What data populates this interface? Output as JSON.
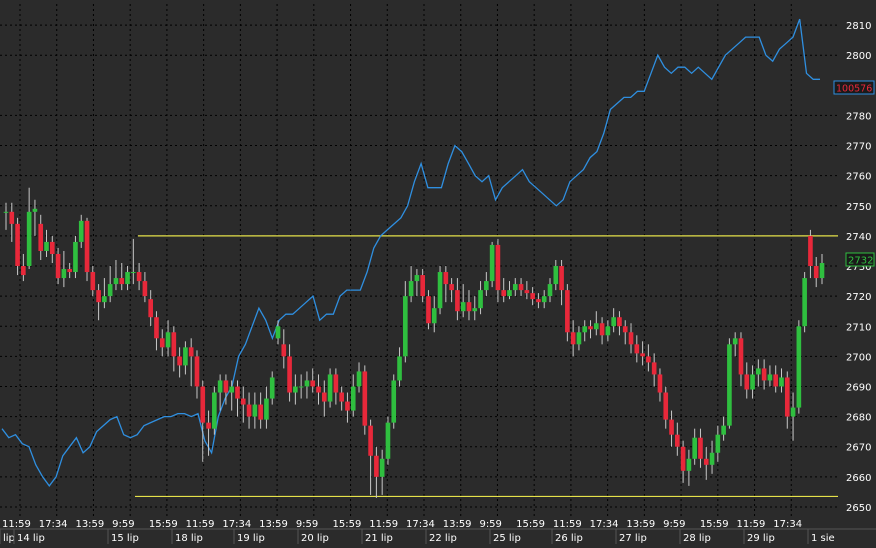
{
  "colors": {
    "background": "#2b2b2b",
    "grid": "#000000",
    "bull_candle": "#2fbf3f",
    "bear_candle": "#e8283a",
    "wick": "#c8c8c8",
    "overlay_line": "#2f8fe0",
    "level_line": "#e6e24a",
    "axis_text": "#ffffff",
    "price_box_border": "#2f8fe0",
    "price_box_text": "#e8283a",
    "last_price_box_border": "#2fbf3f",
    "last_price_box_text": "#2fbf3f"
  },
  "chart_data": {
    "type": "candlestick",
    "ylim": [
      2647,
      2817
    ],
    "y_ticks": [
      2650,
      2660,
      2670,
      2680,
      2690,
      2700,
      2710,
      2720,
      2730,
      2740,
      2750,
      2760,
      2770,
      2780,
      2800,
      2810
    ],
    "time_labels": [
      "11:59",
      "17:34",
      "13:59",
      "9:59",
      "15:59",
      "11:59",
      "17:34",
      "13:59",
      "9:59",
      "15:59",
      "11:59",
      "17:34",
      "13:59",
      "9:59",
      "15:59",
      "11:59",
      "17:34",
      "13:59",
      "9:59",
      "15:59",
      "11:59",
      "17:34"
    ],
    "day_labels": [
      "lip",
      "14 lip",
      "15 lip",
      "18 lip",
      "19 lip",
      "20 lip",
      "21 lip",
      "22 lip",
      "25 lip",
      "26 lip",
      "27 lip",
      "28 lip",
      "29 lip",
      "1 sie"
    ],
    "horizontal_levels": [
      2740,
      2653.5
    ],
    "overlay_price_label": "100576",
    "last_price_label": "2732",
    "last_price": 2732,
    "candles": [
      [
        2748,
        2748,
        2751,
        2742
      ],
      [
        2748,
        2744,
        2751,
        2738
      ],
      [
        2744,
        2730,
        2746,
        2727
      ],
      [
        2730,
        2727,
        2734,
        2725
      ],
      [
        2730,
        2748,
        2756,
        2729
      ],
      [
        2748,
        2749,
        2752,
        2740
      ],
      [
        2744,
        2735,
        2747,
        2732
      ],
      [
        2735,
        2738,
        2742,
        2733
      ],
      [
        2738,
        2734,
        2740,
        2731
      ],
      [
        2734,
        2726,
        2736,
        2724
      ],
      [
        2726,
        2729,
        2735,
        2723
      ],
      [
        2729,
        2728,
        2731,
        2726
      ],
      [
        2728,
        2738,
        2740,
        2726
      ],
      [
        2738,
        2745,
        2747,
        2736
      ],
      [
        2745,
        2728,
        2746,
        2725
      ],
      [
        2728,
        2722,
        2730,
        2720
      ],
      [
        2722,
        2718,
        2724,
        2712
      ],
      [
        2718,
        2720,
        2726,
        2716
      ],
      [
        2720,
        2724,
        2730,
        2718
      ],
      [
        2724,
        2726,
        2732,
        2722
      ],
      [
        2726,
        2724,
        2731,
        2722
      ],
      [
        2724,
        2728,
        2730,
        2722
      ],
      [
        2728,
        2728,
        2739,
        2724
      ],
      [
        2728,
        2725,
        2731,
        2722
      ],
      [
        2725,
        2720,
        2728,
        2718
      ],
      [
        2719,
        2713,
        2722,
        2710
      ],
      [
        2713,
        2706,
        2715,
        2702
      ],
      [
        2706,
        2703,
        2709,
        2700
      ],
      [
        2703,
        2708,
        2712,
        2700
      ],
      [
        2708,
        2700,
        2710,
        2695
      ],
      [
        2700,
        2697,
        2703,
        2693
      ],
      [
        2697,
        2703,
        2705,
        2694
      ],
      [
        2703,
        2700,
        2706,
        2690
      ],
      [
        2700,
        2690,
        2702,
        2686
      ],
      [
        2690,
        2678,
        2692,
        2665
      ],
      [
        2678,
        2676,
        2682,
        2667
      ],
      [
        2676,
        2688,
        2690,
        2674
      ],
      [
        2688,
        2692,
        2694,
        2682
      ],
      [
        2692,
        2688,
        2694,
        2684
      ],
      [
        2688,
        2690,
        2692,
        2682
      ],
      [
        2690,
        2686,
        2692,
        2680
      ],
      [
        2686,
        2684,
        2690,
        2678
      ],
      [
        2684,
        2680,
        2688,
        2676
      ],
      [
        2680,
        2684,
        2688,
        2676
      ],
      [
        2684,
        2679,
        2688,
        2676
      ],
      [
        2679,
        2686,
        2690,
        2676
      ],
      [
        2686,
        2693,
        2695,
        2684
      ],
      [
        2706,
        2710,
        2712,
        2704
      ],
      [
        2704,
        2700,
        2709,
        2696
      ],
      [
        2700,
        2688,
        2704,
        2685
      ],
      [
        2688,
        2690,
        2694,
        2684
      ],
      [
        2690,
        2690,
        2694,
        2686
      ],
      [
        2690,
        2692,
        2695,
        2686
      ],
      [
        2692,
        2690,
        2696,
        2688
      ],
      [
        2690,
        2688,
        2694,
        2684
      ],
      [
        2688,
        2685,
        2692,
        2680
      ],
      [
        2685,
        2694,
        2696,
        2683
      ],
      [
        2694,
        2688,
        2696,
        2684
      ],
      [
        2688,
        2685,
        2690,
        2682
      ],
      [
        2685,
        2682,
        2688,
        2678
      ],
      [
        2682,
        2690,
        2694,
        2680
      ],
      [
        2690,
        2695,
        2698,
        2688
      ],
      [
        2695,
        2677,
        2697,
        2674
      ],
      [
        2677,
        2667,
        2679,
        2654
      ],
      [
        2667,
        2660,
        2670,
        2653
      ],
      [
        2660,
        2666,
        2669,
        2654
      ],
      [
        2666,
        2678,
        2680,
        2664
      ],
      [
        2678,
        2692,
        2694,
        2676
      ],
      [
        2692,
        2700,
        2703,
        2690
      ],
      [
        2700,
        2720,
        2725,
        2698
      ],
      [
        2720,
        2725,
        2730,
        2718
      ],
      [
        2725,
        2727,
        2729,
        2720
      ],
      [
        2727,
        2720,
        2729,
        2718
      ],
      [
        2720,
        2711,
        2722,
        2709
      ],
      [
        2711,
        2716,
        2720,
        2708
      ],
      [
        2716,
        2728,
        2730,
        2714
      ],
      [
        2728,
        2724,
        2730,
        2718
      ],
      [
        2724,
        2722,
        2726,
        2718
      ],
      [
        2722,
        2715,
        2726,
        2712
      ],
      [
        2715,
        2718,
        2724,
        2713
      ],
      [
        2718,
        2715,
        2722,
        2712
      ],
      [
        2715,
        2716,
        2720,
        2712
      ],
      [
        2716,
        2722,
        2725,
        2714
      ],
      [
        2722,
        2725,
        2728,
        2720
      ],
      [
        2725,
        2737,
        2738,
        2723
      ],
      [
        2737,
        2722,
        2739,
        2718
      ],
      [
        2722,
        2720,
        2726,
        2718
      ],
      [
        2720,
        2722,
        2725,
        2719
      ],
      [
        2722,
        2724,
        2726,
        2720
      ],
      [
        2724,
        2722,
        2726,
        2720
      ],
      [
        2722,
        2721,
        2725,
        2719
      ],
      [
        2721,
        2719,
        2723,
        2717
      ],
      [
        2719,
        2718,
        2721,
        2716
      ],
      [
        2718,
        2720,
        2722,
        2716
      ],
      [
        2720,
        2724,
        2726,
        2718
      ],
      [
        2724,
        2730,
        2732,
        2722
      ],
      [
        2730,
        2722,
        2732,
        2717
      ],
      [
        2722,
        2708,
        2724,
        2705
      ],
      [
        2708,
        2704,
        2712,
        2700
      ],
      [
        2704,
        2708,
        2710,
        2702
      ],
      [
        2708,
        2710,
        2712,
        2705
      ],
      [
        2710,
        2709,
        2712,
        2706
      ],
      [
        2709,
        2711,
        2715,
        2707
      ],
      [
        2711,
        2707,
        2713,
        2704
      ],
      [
        2707,
        2710,
        2712,
        2705
      ],
      [
        2710,
        2713,
        2716,
        2708
      ],
      [
        2713,
        2710,
        2715,
        2707
      ],
      [
        2710,
        2708,
        2712,
        2704
      ],
      [
        2708,
        2704,
        2711,
        2701
      ],
      [
        2704,
        2701,
        2707,
        2698
      ],
      [
        2701,
        2700,
        2705,
        2697
      ],
      [
        2700,
        2698,
        2704,
        2695
      ],
      [
        2698,
        2694,
        2701,
        2690
      ],
      [
        2694,
        2688,
        2696,
        2685
      ],
      [
        2688,
        2679,
        2690,
        2676
      ],
      [
        2679,
        2674,
        2682,
        2670
      ],
      [
        2674,
        2670,
        2678,
        2667
      ],
      [
        2670,
        2662,
        2672,
        2658
      ],
      [
        2662,
        2666,
        2669,
        2657
      ],
      [
        2666,
        2673,
        2676,
        2664
      ],
      [
        2673,
        2666,
        2676,
        2663
      ],
      [
        2666,
        2664,
        2670,
        2659
      ],
      [
        2664,
        2668,
        2672,
        2661
      ],
      [
        2668,
        2674,
        2677,
        2665
      ],
      [
        2674,
        2677,
        2680,
        2672
      ],
      [
        2677,
        2704,
        2706,
        2676
      ],
      [
        2704,
        2706,
        2708,
        2700
      ],
      [
        2706,
        2694,
        2708,
        2690
      ],
      [
        2694,
        2689,
        2698,
        2686
      ],
      [
        2689,
        2694,
        2697,
        2686
      ],
      [
        2694,
        2696,
        2699,
        2690
      ],
      [
        2696,
        2692,
        2699,
        2689
      ],
      [
        2692,
        2694,
        2697,
        2690
      ],
      [
        2694,
        2690,
        2697,
        2688
      ],
      [
        2690,
        2693,
        2696,
        2688
      ],
      [
        2693,
        2680,
        2695,
        2676
      ],
      [
        2680,
        2683,
        2688,
        2672
      ],
      [
        2683,
        2710,
        2712,
        2681
      ],
      [
        2710,
        2726,
        2728,
        2708
      ],
      [
        2740,
        2730,
        2742,
        2726
      ],
      [
        2730,
        2726,
        2733,
        2723
      ],
      [
        2726,
        2731,
        2734,
        2724
      ]
    ],
    "overlay_series": [
      2676,
      2673,
      2674,
      2671,
      2670,
      2664,
      2660,
      2657,
      2660,
      2667,
      2670,
      2673,
      2668,
      2670,
      2675,
      2677,
      2679,
      2680,
      2674,
      2673,
      2674,
      2677,
      2678,
      2679,
      2680,
      2680,
      2681,
      2681,
      2680,
      2681,
      2672,
      2668,
      2680,
      2686,
      2690,
      2700,
      2704,
      2710,
      2716,
      2712,
      2706,
      2712,
      2714,
      2714,
      2716,
      2718,
      2720,
      2712,
      2714,
      2714,
      2720,
      2722,
      2722,
      2722,
      2728,
      2736,
      2740,
      2742,
      2744,
      2746,
      2750,
      2758,
      2764,
      2756,
      2756,
      2756,
      2764,
      2770,
      2768,
      2764,
      2760,
      2758,
      2760,
      2752,
      2756,
      2758,
      2760,
      2762,
      2758,
      2756,
      2754,
      2752,
      2750,
      2752,
      2758,
      2760,
      2762,
      2766,
      2768,
      2774,
      2782,
      2784,
      2786,
      2786,
      2788,
      2788,
      2794,
      2800,
      2796,
      2794,
      2796,
      2796,
      2794,
      2796,
      2794,
      2792,
      2796,
      2800,
      2802,
      2804,
      2806,
      2806,
      2806,
      2800,
      2798,
      2802,
      2804,
      2806,
      2812,
      2794,
      2792,
      2792
    ]
  }
}
